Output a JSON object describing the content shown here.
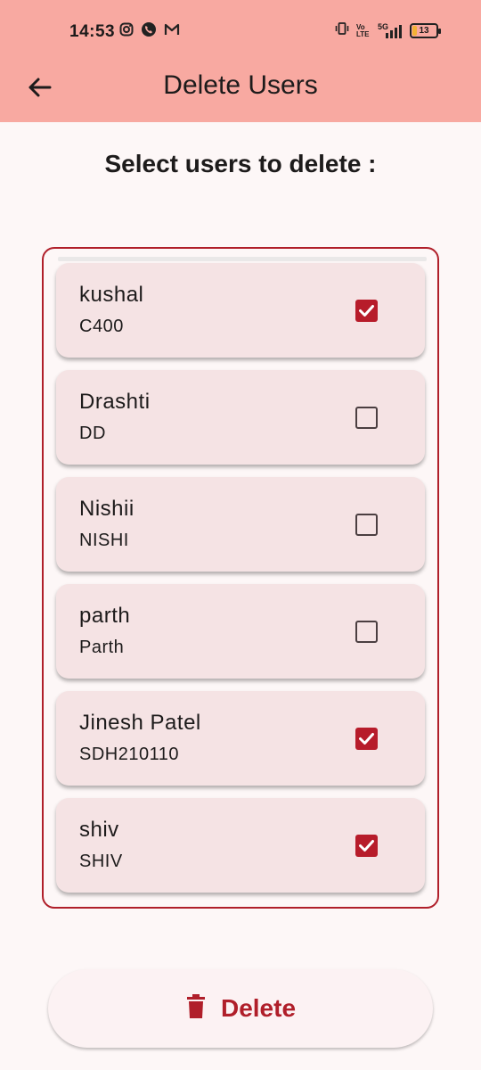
{
  "status_bar": {
    "time": "14:53",
    "left_icons": [
      "instagram-icon",
      "whatsapp-icon",
      "gmail-icon"
    ],
    "right_icons": [
      "vibrate-icon",
      "volte-icon",
      "signal-5g-icon",
      "battery-icon"
    ],
    "volte_label": "Vo LTE",
    "network_label": "5G",
    "battery_level": "13"
  },
  "app_bar": {
    "title": "Delete Users",
    "back_icon": "arrow-left-icon"
  },
  "heading": "Select users to delete :",
  "users": [
    {
      "name": "kushal",
      "code": "C400",
      "checked": true
    },
    {
      "name": "Drashti",
      "code": "DD",
      "checked": false
    },
    {
      "name": "Nishii",
      "code": "NISHI",
      "checked": false
    },
    {
      "name": "parth",
      "code": "Parth",
      "checked": false
    },
    {
      "name": "Jinesh Patel",
      "code": "SDH210110",
      "checked": true
    },
    {
      "name": "shiv",
      "code": "SHIV",
      "checked": true
    }
  ],
  "delete_button": {
    "label": "Delete",
    "icon": "trash-icon"
  },
  "colors": {
    "app_bar": "#f8a9a1",
    "accent": "#b01f2a",
    "card": "#f5e3e4",
    "background": "#fdf7f7"
  }
}
